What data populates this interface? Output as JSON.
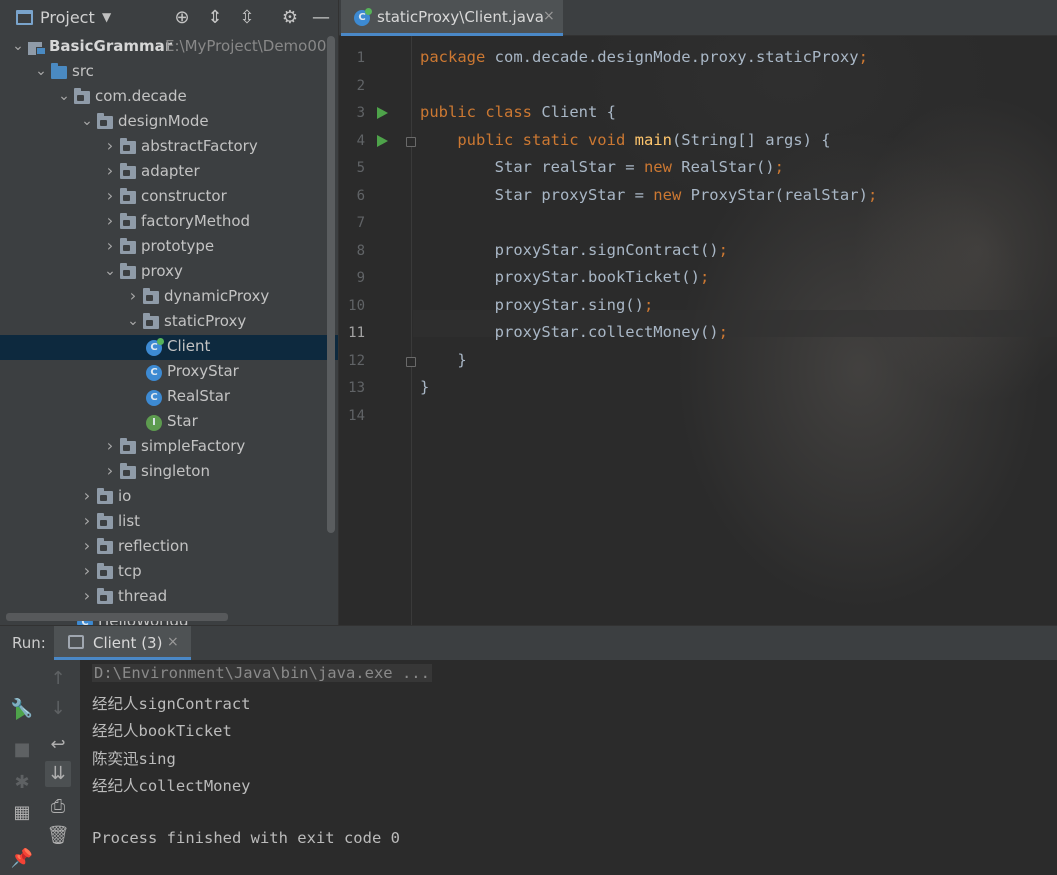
{
  "project_panel": {
    "title": "Project",
    "caret": "▼",
    "tree": [
      {
        "depth": 0,
        "type": "module",
        "label": "BasicGrammar",
        "path": "E:\\MyProject\\Demo00",
        "expanded": true
      },
      {
        "depth": 1,
        "type": "src",
        "label": "src",
        "expanded": true
      },
      {
        "depth": 2,
        "type": "package",
        "label": "com.decade",
        "expanded": true
      },
      {
        "depth": 3,
        "type": "package",
        "label": "designMode",
        "expanded": true
      },
      {
        "depth": 4,
        "type": "package",
        "label": "abstractFactory",
        "expanded": false
      },
      {
        "depth": 4,
        "type": "package",
        "label": "adapter",
        "expanded": false
      },
      {
        "depth": 4,
        "type": "package",
        "label": "constructor",
        "expanded": false
      },
      {
        "depth": 4,
        "type": "package",
        "label": "factoryMethod",
        "expanded": false
      },
      {
        "depth": 4,
        "type": "package",
        "label": "prototype",
        "expanded": false
      },
      {
        "depth": 4,
        "type": "package",
        "label": "proxy",
        "expanded": true
      },
      {
        "depth": 5,
        "type": "package",
        "label": "dynamicProxy",
        "expanded": false
      },
      {
        "depth": 5,
        "type": "package",
        "label": "staticProxy",
        "expanded": true
      },
      {
        "depth": 6,
        "type": "class-run",
        "label": "Client",
        "selected": true
      },
      {
        "depth": 6,
        "type": "class",
        "label": "ProxyStar"
      },
      {
        "depth": 6,
        "type": "class",
        "label": "RealStar"
      },
      {
        "depth": 6,
        "type": "interface",
        "label": "Star"
      },
      {
        "depth": 4,
        "type": "package",
        "label": "simpleFactory",
        "expanded": false
      },
      {
        "depth": 4,
        "type": "package",
        "label": "singleton",
        "expanded": false
      },
      {
        "depth": 3,
        "type": "package",
        "label": "io",
        "expanded": false
      },
      {
        "depth": 3,
        "type": "package",
        "label": "list",
        "expanded": false
      },
      {
        "depth": 3,
        "type": "package",
        "label": "reflection",
        "expanded": false
      },
      {
        "depth": 3,
        "type": "package",
        "label": "tcp",
        "expanded": false
      },
      {
        "depth": 3,
        "type": "package",
        "label": "thread",
        "expanded": false
      },
      {
        "depth": 3,
        "type": "class-run",
        "label": "HelloWorldd"
      }
    ]
  },
  "editor": {
    "tab_label": "staticProxy\\Client.java",
    "tab_close": "×",
    "current_line": 11,
    "run_markers": [
      3,
      4
    ],
    "fold_markers": [
      4,
      12
    ],
    "lines": [
      [
        [
          "kw",
          "package "
        ],
        [
          "pk",
          "com.decade.designMode.proxy.staticProxy"
        ],
        [
          "kw",
          ";"
        ]
      ],
      [],
      [
        [
          "kw",
          "public class "
        ],
        [
          "pk",
          "Client {"
        ]
      ],
      [
        [
          "pk",
          "    "
        ],
        [
          "kw",
          "public static void "
        ],
        [
          "fn",
          "main"
        ],
        [
          "pk",
          "(String[] args) {"
        ]
      ],
      [
        [
          "pk",
          "        Star realStar = "
        ],
        [
          "kw",
          "new "
        ],
        [
          "pk",
          "RealStar()"
        ],
        [
          "kw",
          ";"
        ]
      ],
      [
        [
          "pk",
          "        Star proxyStar = "
        ],
        [
          "kw",
          "new "
        ],
        [
          "pk",
          "ProxyStar(realStar)"
        ],
        [
          "kw",
          ";"
        ]
      ],
      [],
      [
        [
          "pk",
          "        proxyStar.signContract()"
        ],
        [
          "kw",
          ";"
        ]
      ],
      [
        [
          "pk",
          "        proxyStar.bookTicket()"
        ],
        [
          "kw",
          ";"
        ]
      ],
      [
        [
          "pk",
          "        proxyStar.sing()"
        ],
        [
          "kw",
          ";"
        ]
      ],
      [
        [
          "pk",
          "        proxyStar.collectMoney()"
        ],
        [
          "kw",
          ";"
        ]
      ],
      [
        [
          "pk",
          "    }"
        ]
      ],
      [
        [
          "pk",
          "}"
        ]
      ],
      []
    ]
  },
  "run_panel": {
    "title": "Run:",
    "tab_label": "Client (3)",
    "tab_close": "×",
    "output": [
      {
        "text": "D:\\Environment\\Java\\bin\\java.exe ...",
        "kind": "cmd"
      },
      {
        "text": "经纪人signContract",
        "kind": "out"
      },
      {
        "text": "经纪人bookTicket",
        "kind": "out"
      },
      {
        "text": "陈奕迅sing",
        "kind": "out"
      },
      {
        "text": "经纪人collectMoney",
        "kind": "out"
      },
      {
        "text": "",
        "kind": "out"
      },
      {
        "text": "Process finished with exit code 0",
        "kind": "out"
      }
    ]
  }
}
